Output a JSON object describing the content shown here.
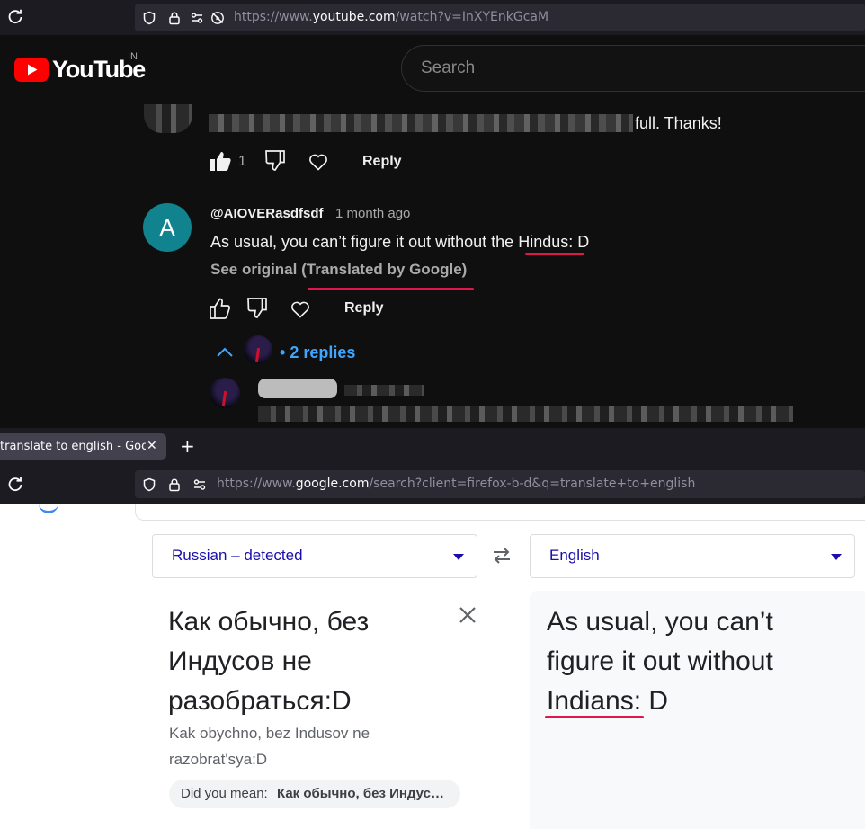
{
  "youtube_window": {
    "url_prefix": "https://www.",
    "url_host": "youtube.com",
    "url_path": "/watch?v=InXYEnkGcaM",
    "logo_text": "YouTube",
    "country_code": "IN",
    "search_placeholder": "Search",
    "prev_comment": {
      "visible_text": "full. Thanks!",
      "like_count": "1",
      "reply_label": "Reply"
    },
    "comment": {
      "avatar_letter": "A",
      "author": "@AIOVERasdfsdf",
      "time": "1 month ago",
      "text_before": "As usual, you can’t figure it out without the ",
      "highlight_word": "Hindus",
      "text_after": ": D",
      "see_original": "See original",
      "translated_note": "(Translated by Google)",
      "reply_label": "Reply",
      "replies_bullet": "•",
      "replies_label": "2 replies"
    }
  },
  "tab_bar": {
    "tab_title": "translate to english - Google",
    "tab_close": "✕",
    "new_tab": "+"
  },
  "google_window": {
    "url_prefix": "https://www.",
    "url_host": "google.com",
    "url_path": "/search?client=firefox-b-d&q=translate+to+english"
  },
  "translate": {
    "source_lang": "Russian – detected",
    "target_lang": "English",
    "source_text": "Как обычно, без Индусов не разобраться:D",
    "transliteration": "Kak obychno, bez Indusov ne razobrat'sya:D",
    "did_you_mean_label": "Did you mean:",
    "did_you_mean_value": "Как обычно, без Индусов не разобраться",
    "target_text_before": "As usual, you can’t figure it out without ",
    "target_highlight": "Indians",
    "target_text_after": ": D"
  },
  "colors": {
    "yt_bg": "#0f0f0f",
    "yt_red": "#ff0000",
    "link_blue": "#3ea6ff",
    "annotation_red": "#e0164c",
    "avatar_teal": "#11838f",
    "gt_lang_blue": "#1a0dab"
  }
}
